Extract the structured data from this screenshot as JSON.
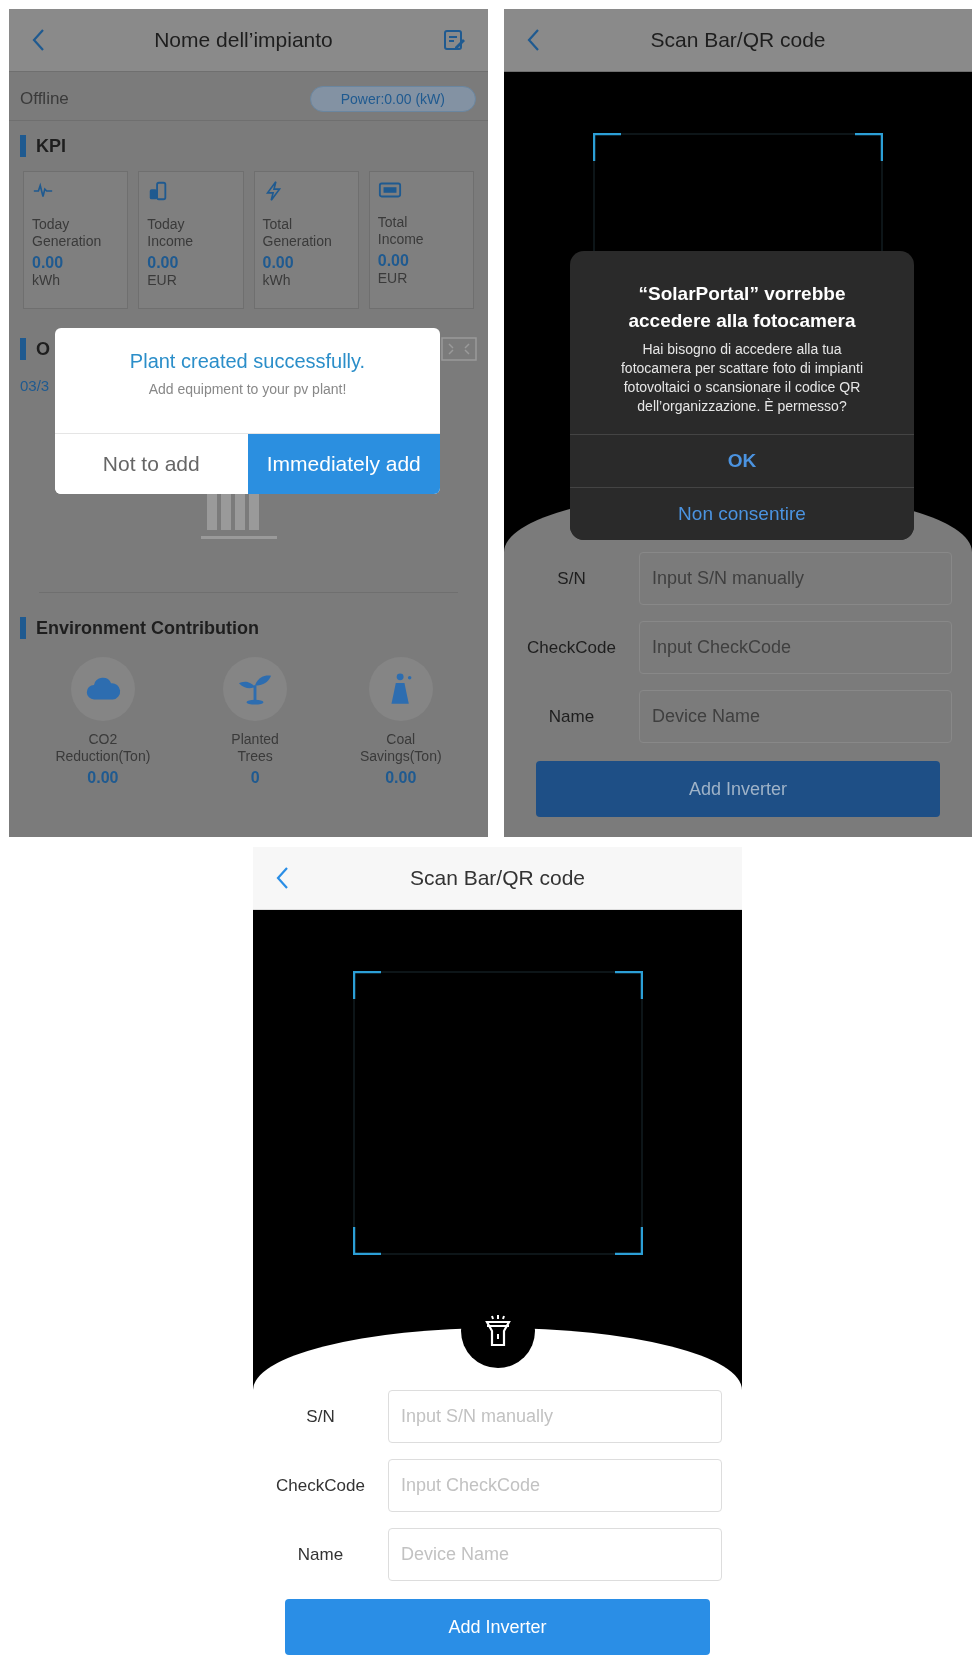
{
  "screens": [
    {
      "kind": "plant",
      "dimmed": true,
      "title": "Nome dell’impianto",
      "status": "Offline",
      "power": "Power:0.00 (kW)",
      "kpi_heading": "KPI",
      "kpis": [
        {
          "kind": "pulse",
          "label": "Today Generation",
          "value": "0.00",
          "unit": "kWh"
        },
        {
          "kind": "coins",
          "label": "Today Income",
          "value": "0.00",
          "unit": "EUR"
        },
        {
          "kind": "bolt",
          "label": "Total Generation",
          "value": "0.00",
          "unit": "kWh"
        },
        {
          "kind": "money",
          "label": "Total Income",
          "value": "0.00",
          "unit": "EUR"
        }
      ],
      "chart_heading": "O",
      "date": "03/3",
      "env_heading": "Environment Contribution",
      "env": [
        {
          "kind": "cloud",
          "label": "CO2 Reduction(Ton)",
          "value": "0.00"
        },
        {
          "kind": "sprout",
          "label": "Planted Trees",
          "value": "0"
        },
        {
          "kind": "tower",
          "label": "Coal Savings(Ton)",
          "value": "0.00"
        }
      ],
      "dialog": {
        "title": "Plant created successfully.",
        "message": "Add equipment to your pv plant!",
        "buttons": [
          {
            "label": "Not to add",
            "primary": false
          },
          {
            "label": "Immediately add",
            "primary": true
          }
        ]
      }
    },
    {
      "kind": "scan",
      "dimmed": true,
      "title": "Scan Bar/QR code",
      "fields": [
        {
          "label": "S/N",
          "placeholder": "Input S/N manually"
        },
        {
          "label": "CheckCode",
          "placeholder": "Input CheckCode"
        },
        {
          "label": "Name",
          "placeholder": "Device Name"
        }
      ],
      "submit": "Add Inverter",
      "alert": {
        "title": "“SolarPortal” vorrebbe accedere alla fotocamera",
        "message": "Hai bisogno di accedere alla tua fotocamera per scattare foto di impianti fotovoltaici o scansionare il codice QR dell’organizzazione. È permesso?",
        "buttons": [
          "OK",
          "Non consentire"
        ]
      }
    },
    {
      "kind": "scan",
      "dimmed": false,
      "title": "Scan Bar/QR code",
      "fields": [
        {
          "label": "S/N",
          "placeholder": "Input S/N manually"
        },
        {
          "label": "CheckCode",
          "placeholder": "Input CheckCode"
        },
        {
          "label": "Name",
          "placeholder": "Device Name"
        }
      ],
      "submit": "Add Inverter"
    }
  ]
}
